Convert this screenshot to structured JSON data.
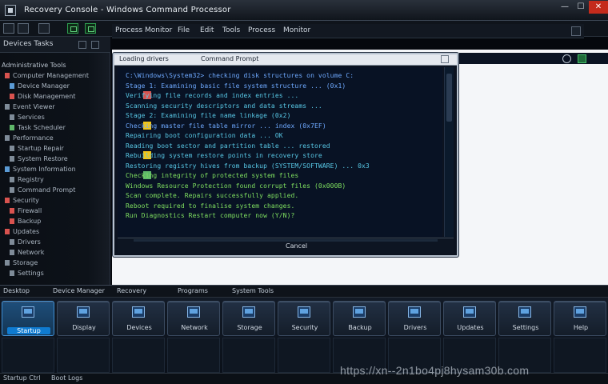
{
  "window": {
    "title": "Recovery Console - Windows Command Processor",
    "controls": {
      "minimize": "—",
      "maximize": "☐",
      "close": "✕"
    }
  },
  "toolbar": {
    "menu": [
      "Process Monitor",
      "File",
      "Edit",
      "Tools",
      "Process",
      "Monitor"
    ]
  },
  "left_panel": {
    "header": "Devices Tasks",
    "subheader": "Administrative Tools",
    "items": [
      {
        "label": "Computer Management",
        "color": "#d9534f"
      },
      {
        "label": "Device Manager",
        "color": "#5b9bd5"
      },
      {
        "label": "Disk Management",
        "color": "#d9534f"
      },
      {
        "label": "Event Viewer",
        "color": "#7f8c99"
      },
      {
        "label": "Services",
        "color": "#7f8c99"
      },
      {
        "label": "Task Scheduler",
        "color": "#5fb86a"
      },
      {
        "label": "Performance",
        "color": "#7f8c99"
      },
      {
        "label": "Startup Repair",
        "color": "#7f8c99"
      },
      {
        "label": "System Restore",
        "color": "#7f8c99"
      },
      {
        "label": "System Information",
        "color": "#5b9bd5"
      },
      {
        "label": "Registry",
        "color": "#7f8c99"
      },
      {
        "label": "Command Prompt",
        "color": "#7f8c99"
      },
      {
        "label": "Security",
        "color": "#d9534f"
      },
      {
        "label": "Firewall",
        "color": "#d9534f"
      },
      {
        "label": "Backup",
        "color": "#d9534f"
      },
      {
        "label": "Updates",
        "color": "#d9534f"
      },
      {
        "label": "Drivers",
        "color": "#7f8c99"
      },
      {
        "label": "Network",
        "color": "#7f8c99"
      },
      {
        "label": "Storage",
        "color": "#7f8c99"
      },
      {
        "label": "Settings",
        "color": "#7f8c99"
      }
    ]
  },
  "dialog": {
    "title_left": "Loading drivers",
    "title_right": "Command Prompt",
    "lines": [
      {
        "text": "C:\\Windows\\System32> checking disk structures on volume C:",
        "color": "blue",
        "icon": ""
      },
      {
        "text": "  Stage 1: Examining basic file system structure ... (0x1)",
        "color": "blue",
        "icon": ""
      },
      {
        "text": "  Verifying file records and index entries ...",
        "color": "cyan",
        "icon": "#d9534f"
      },
      {
        "text": "  Scanning security descriptors and data streams ...",
        "color": "cyan",
        "icon": ""
      },
      {
        "text": "  Stage 2: Examining file name linkage (0x2)",
        "color": "cyan",
        "icon": ""
      },
      {
        "text": "  Checking master file table mirror ... index (0x7EF)",
        "color": "blue",
        "icon": "#f0c419"
      },
      {
        "text": "  Repairing boot configuration data ... OK",
        "color": "cyan",
        "icon": ""
      },
      {
        "text": "  Reading boot sector and partition table ... restored",
        "color": "cyan",
        "icon": ""
      },
      {
        "text": "  Rebuilding system restore points in recovery store",
        "color": "cyan",
        "icon": "#f0c419"
      },
      {
        "text": "  Restoring registry hives from backup (SYSTEM/SOFTWARE) ... 0x3",
        "color": "cyan",
        "icon": ""
      },
      {
        "text": "  Checking integrity of protected system files",
        "color": "green",
        "icon": "#5fb86a"
      },
      {
        "text": "  Windows Resource Protection found corrupt files (0x000B)",
        "color": "green",
        "icon": ""
      },
      {
        "text": "  Scan complete. Repairs successfully applied.",
        "color": "green",
        "icon": ""
      },
      {
        "text": "  Reboot required to finalise system changes.",
        "color": "green",
        "icon": ""
      },
      {
        "text": "  Run Diagnostics   Restart computer now (Y/N)?",
        "color": "green",
        "icon": ""
      }
    ],
    "button": "Cancel"
  },
  "taskbar": {
    "tabs": [
      "Desktop",
      "Device Manager",
      "Recovery",
      "Programs",
      "System Tools"
    ],
    "tiles": [
      {
        "label": "Startup"
      },
      {
        "label": "Display"
      },
      {
        "label": "Devices"
      },
      {
        "label": "Network"
      },
      {
        "label": "Storage"
      },
      {
        "label": "Security"
      },
      {
        "label": "Backup"
      },
      {
        "label": "Drivers"
      },
      {
        "label": "Updates"
      },
      {
        "label": "Settings"
      },
      {
        "label": "Help"
      }
    ],
    "status_left": "Startup Ctrl",
    "status_mid": "Boot Logs"
  },
  "watermark": "https://xn--2n1bo4pj8hysam30b.com"
}
